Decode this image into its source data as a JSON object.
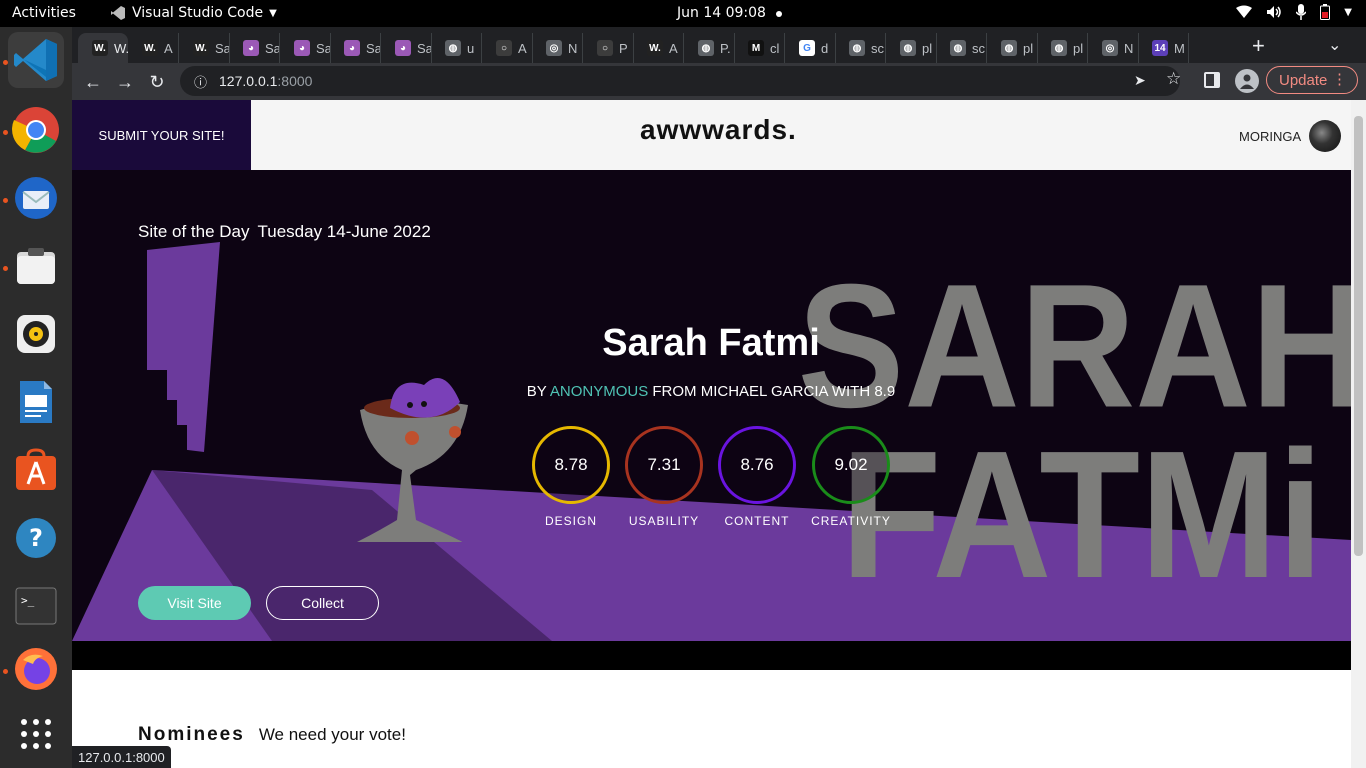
{
  "system_bar": {
    "activities": "Activities",
    "app_name": "Visual Studio Code",
    "clock": "Jun 14  09:08"
  },
  "dock": {
    "items": [
      "vscode-icon",
      "chrome-icon",
      "thunderbird-icon",
      "files-icon",
      "rhythmbox-icon",
      "writer-icon",
      "software-icon",
      "help-icon",
      "terminal-icon",
      "firefox-icon",
      "app-grid-icon"
    ]
  },
  "browser": {
    "tabs": [
      {
        "label": "W.",
        "fav": "W."
      },
      {
        "label": "A",
        "fav": "W."
      },
      {
        "label": "Sa",
        "fav": "W."
      },
      {
        "label": "Sa",
        "fav": "◕"
      },
      {
        "label": "Sa",
        "fav": "◕"
      },
      {
        "label": "Sa",
        "fav": "◕"
      },
      {
        "label": "Sa",
        "fav": "◕"
      },
      {
        "label": "u",
        "fav": "◍"
      },
      {
        "label": "A",
        "fav": "○"
      },
      {
        "label": "N",
        "fav": "◎"
      },
      {
        "label": "P",
        "fav": "○"
      },
      {
        "label": "A",
        "fav": "W."
      },
      {
        "label": "P.",
        "fav": "◍"
      },
      {
        "label": "cl",
        "fav": "M"
      },
      {
        "label": "d",
        "fav": "G"
      },
      {
        "label": "sc",
        "fav": "◍"
      },
      {
        "label": "pl",
        "fav": "◍"
      },
      {
        "label": "sc",
        "fav": "◍"
      },
      {
        "label": "pl",
        "fav": "◍"
      },
      {
        "label": "pl",
        "fav": "◍"
      },
      {
        "label": "N",
        "fav": "◎"
      },
      {
        "label": "M",
        "fav": "14"
      }
    ],
    "url_host": "127.0.0.1",
    "url_port": ":8000",
    "update_label": "Update",
    "status_url": "127.0.0.1:8000"
  },
  "site": {
    "submit_label": "SUBMIT YOUR SITE!",
    "logo": "awwwards.",
    "user": "MORINGA",
    "hero": {
      "sotd_label": "Site of the Day",
      "date": "Tuesday 14-June 2022",
      "title": "Sarah Fatmi",
      "by": "BY",
      "author": "ANONYMOUS",
      "from_text": "FROM MICHAEL GARCIA WITH 8.9",
      "art_text_1": "SARAH",
      "art_text_2": "FATMi",
      "scores": [
        {
          "value": "8.78",
          "label": "DESIGN",
          "color": "#e6b800"
        },
        {
          "value": "7.31",
          "label": "USABILITY",
          "color": "#a8331f"
        },
        {
          "value": "8.76",
          "label": "CONTENT",
          "color": "#6a14e0"
        },
        {
          "value": "9.02",
          "label": "CREATIVITY",
          "color": "#1a8c1a"
        }
      ],
      "visit_label": "Visit Site",
      "collect_label": "Collect"
    },
    "nominees_title": "Nominees",
    "nominees_sub": "We need your vote!"
  },
  "colors": {
    "accent_teal": "#5ecab3",
    "hero_purple": "#6b3a9c",
    "submit_bg": "#1a0a3a"
  }
}
